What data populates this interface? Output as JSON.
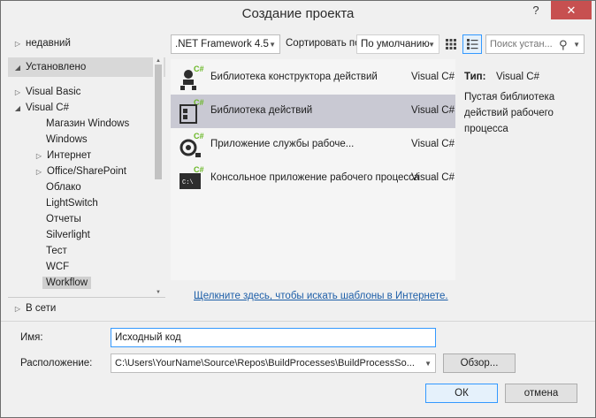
{
  "window": {
    "title": "Создание проекта"
  },
  "tree": {
    "recent": "недавний",
    "installed": "Установлено",
    "visual_basic": "Visual Basic",
    "visual_csharp": "Visual C#",
    "children": [
      "Магазин Windows",
      "Windows",
      "Интернет",
      "Office/SharePoint",
      "Облако",
      "LightSwitch",
      "Отчеты",
      "Silverlight",
      "Тест",
      "WCF",
      "Workflow"
    ],
    "online": "В сети"
  },
  "toolbar": {
    "framework": ".NET Framework 4.5",
    "sort_label": "Сортировать по:",
    "sort_value": "По умолчанию",
    "search_placeholder": "Поиск устан..."
  },
  "templates": [
    {
      "name": "Библиотека конструктора действий",
      "lang": "Visual C#"
    },
    {
      "name": "Библиотека действий",
      "lang": "Visual C#"
    },
    {
      "name": "Приложение службы рабоче...",
      "lang": "Visual C#"
    },
    {
      "name": "Консольное приложение рабочего процесса",
      "lang": "Visual C#"
    }
  ],
  "online_link": "Щелкните здесь, чтобы искать шаблоны в Интернете.",
  "details": {
    "type_label": "Тип:",
    "type_value": "Visual C#",
    "description": "Пустая библиотека действий рабочего процесса"
  },
  "form": {
    "name_label": "Имя:",
    "name_value": "Исходный код",
    "location_label": "Расположение:",
    "location_value": "C:\\Users\\YourName\\Source\\Repos\\BuildProcesses\\BuildProcessSo...",
    "browse": "Обзор...",
    "ok": "ОК",
    "cancel": "отмена"
  },
  "colors": {
    "accent": "#3399ff",
    "close": "#c75050",
    "link": "#1d5ea8",
    "selection": "#c9c9d3",
    "csharp_green": "#68b723"
  }
}
